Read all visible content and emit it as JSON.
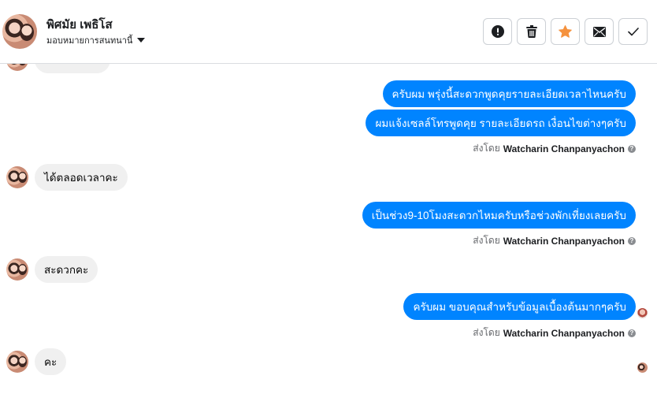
{
  "header": {
    "contact_name": "พิศมัย เพธิโส",
    "assign_label": "มอบหมายการสนทนานี้"
  },
  "actions": [
    {
      "name": "mark-spam-button",
      "icon": "exclamation-icon"
    },
    {
      "name": "delete-button",
      "icon": "trash-icon"
    },
    {
      "name": "star-button",
      "icon": "star-icon",
      "color": "#f5923e"
    },
    {
      "name": "mark-unread-button",
      "icon": "envelope-icon"
    },
    {
      "name": "mark-done-button",
      "icon": "check-icon"
    }
  ],
  "messages": {
    "out1": "ครับผม พรุ่งนี้สะดวกพูดคุยรายละเอียดเวลาไหนครับ",
    "out2": "ผมแจ้งเซลล์โทรพูดคุย รายละเอียดรถ เงื่อนไขต่างๆครับ",
    "in1": "ได้ตลอดเวลาคะ",
    "out3": "เป็นช่วง9-10โมงสะดวกไหมครับหรือช่วงพักเที่ยงเลยครับ",
    "in2": "สะดวกคะ",
    "out4": "ครับผม ขอบคุณสำหรับข้อมูลเบื้องต้นมากๆครับ",
    "in3": "คะ"
  },
  "sent_by": {
    "prefix": "ส่งโดย",
    "name": "Watcharin Chanpanyachon",
    "help": "?"
  },
  "colors": {
    "outgoing_bubble": "#0084ff",
    "incoming_bubble": "#f0f0f0",
    "star": "#f5923e"
  }
}
